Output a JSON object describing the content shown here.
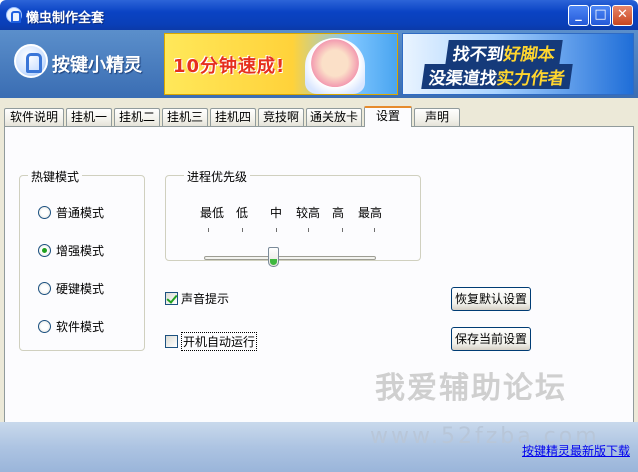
{
  "window": {
    "title": "懒虫制作全套",
    "minimize_glyph": "_",
    "maximize_glyph": "□",
    "close_glyph": "✕"
  },
  "banner": {
    "logo_text": "按键小精灵",
    "ad1_text": "10分钟速成!",
    "ad2_line1_a": "找不到",
    "ad2_line1_b": "好脚本",
    "ad2_line2_a": "没渠道找",
    "ad2_line2_b": "实力作者"
  },
  "tabs": [
    {
      "label": "软件说明"
    },
    {
      "label": "挂机一"
    },
    {
      "label": "挂机二"
    },
    {
      "label": "挂机三"
    },
    {
      "label": "挂机四"
    },
    {
      "label": "竞技啊"
    },
    {
      "label": "通关放卡"
    },
    {
      "label": "设置",
      "active": true
    },
    {
      "label": "声明"
    }
  ],
  "hotkey": {
    "title": "热键模式",
    "options": [
      {
        "label": "普通模式",
        "selected": false
      },
      {
        "label": "增强模式",
        "selected": true
      },
      {
        "label": "硬键模式",
        "selected": false
      },
      {
        "label": "软件模式",
        "selected": false
      }
    ]
  },
  "priority": {
    "title": "进程优先级",
    "levels": [
      "最低",
      "低",
      "中",
      "较高",
      "高",
      "最高"
    ],
    "selected_level": "中"
  },
  "options": {
    "sound_label": "声音提示",
    "sound_checked": true,
    "autostart_label": "开机自动运行",
    "autostart_checked": false
  },
  "buttons": {
    "restore_label": "恢复默认设置",
    "save_label": "保存当前设置"
  },
  "watermark": {
    "main": "我爱辅助论坛",
    "url": "www.52fzba.com"
  },
  "footer": {
    "download_link": "按键精灵最新版下载"
  }
}
